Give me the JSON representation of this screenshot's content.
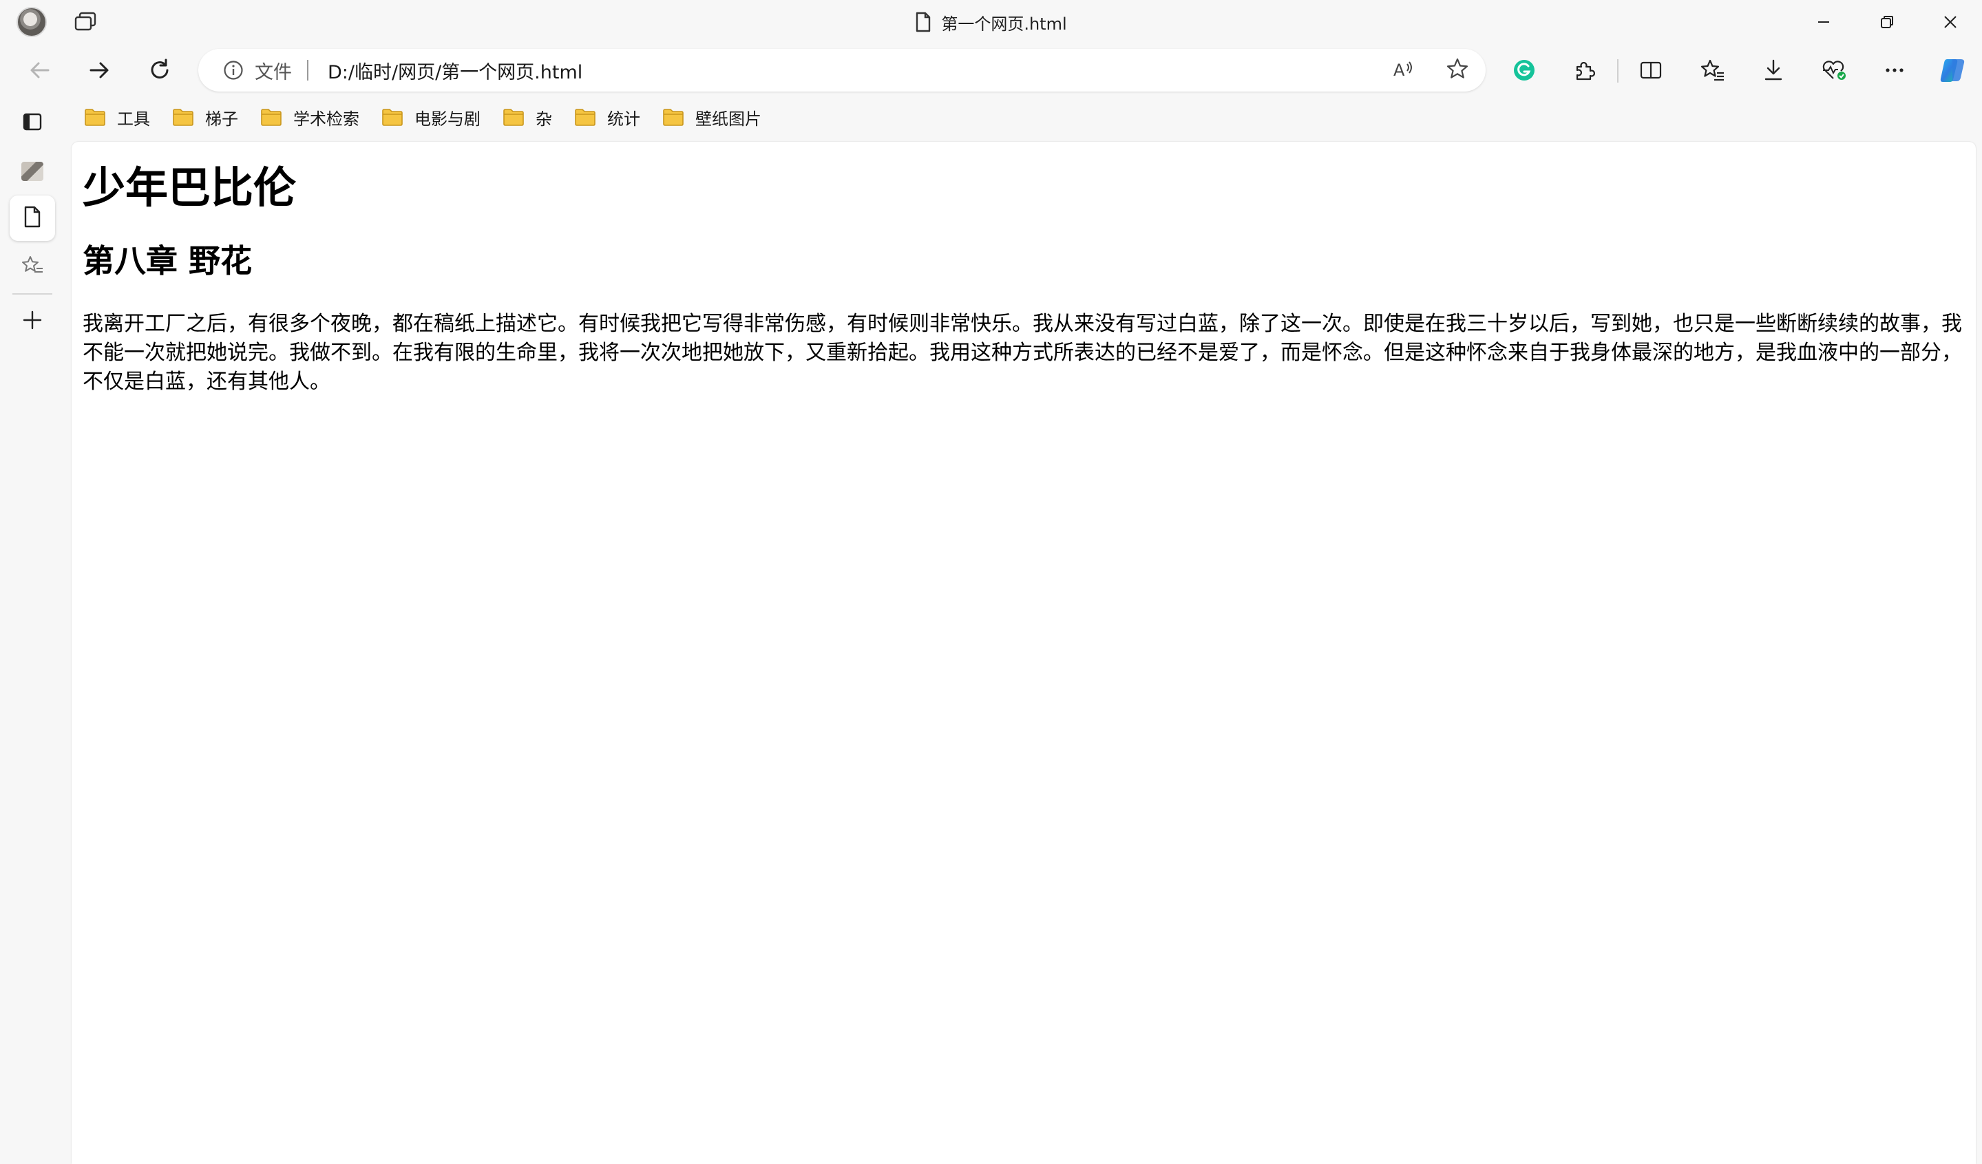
{
  "window": {
    "title": "第一个网页.html"
  },
  "address": {
    "scheme_label": "文件",
    "url": "D:/临时/网页/第一个网页.html"
  },
  "favorites": [
    {
      "label": "工具"
    },
    {
      "label": "梯子"
    },
    {
      "label": "学术检索"
    },
    {
      "label": "电影与剧"
    },
    {
      "label": "杂"
    },
    {
      "label": "统计"
    },
    {
      "label": "壁纸图片"
    }
  ],
  "page": {
    "h1": "少年巴比伦",
    "h2": "第八章 野花",
    "paragraph": "我离开工厂之后，有很多个夜晚，都在稿纸上描述它。有时候我把它写得非常伤感，有时候则非常快乐。我从来没有写过白蓝，除了这一次。即使是在我三十岁以后，写到她，也只是一些断断续续的故事，我不能一次就把她说完。我做不到。在我有限的生命里，我将一次次地把她放下，又重新拾起。我用这种方式所表达的已经不是爱了，而是怀念。但是这种怀念来自于我身体最深的地方，是我血液中的一部分，不仅是白蓝，还有其他人。"
  },
  "colors": {
    "chrome_bg": "#f7f7f7",
    "content_bg": "#ffffff",
    "folder_yellow": "#f5c542",
    "grammarly_green": "#15c39a",
    "copilot_blue": "#2f7de1"
  },
  "icons": {
    "tab_actions": "tab-actions-icon",
    "back": "arrow-left-icon",
    "forward": "arrow-right-icon",
    "refresh": "refresh-icon",
    "info": "info-icon",
    "read_aloud": "read-aloud-icon",
    "favorite": "star-icon",
    "grammarly": "grammarly-icon",
    "extensions": "puzzle-icon",
    "split_screen": "split-screen-icon",
    "favorites": "favorites-icon",
    "downloads": "download-icon",
    "browser_essentials": "heart-pulse-icon",
    "more": "more-icon",
    "copilot": "copilot-icon"
  }
}
